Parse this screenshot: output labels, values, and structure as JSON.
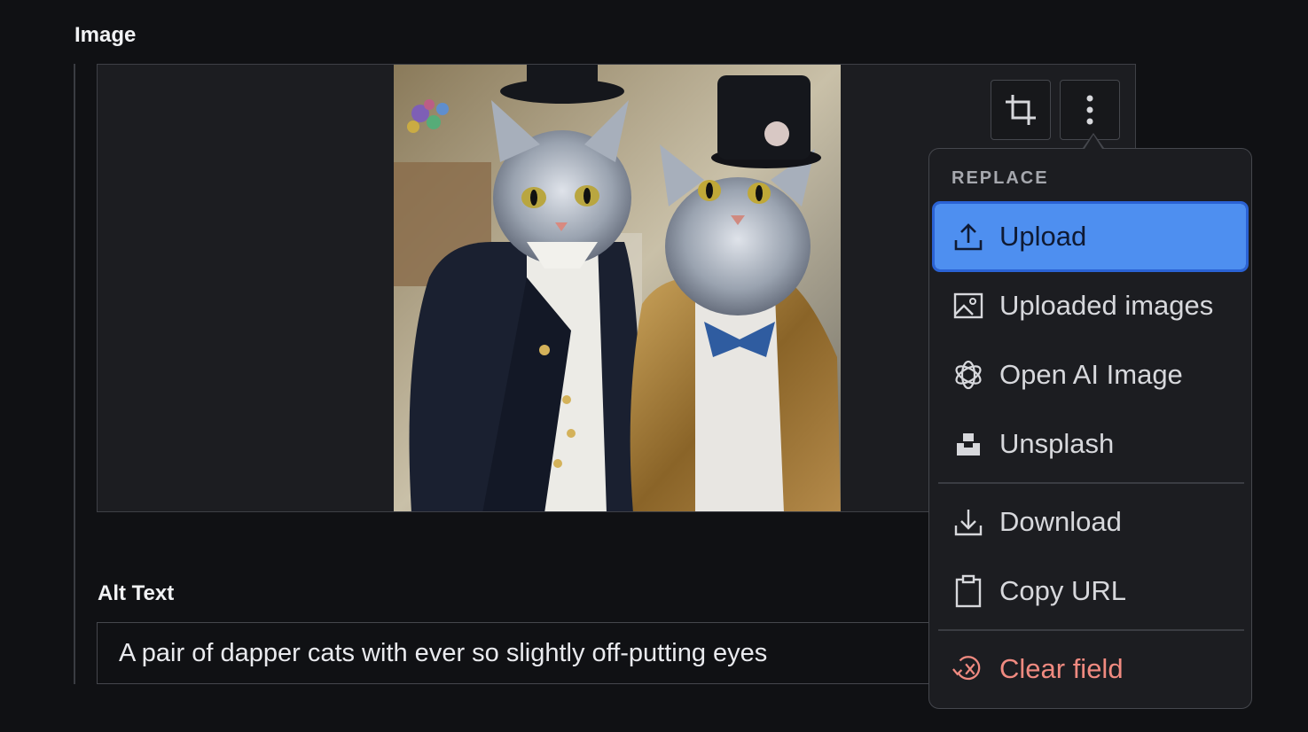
{
  "image_field": {
    "label": "Image"
  },
  "painting": {
    "description_icon": "image-preview"
  },
  "toolbar": {
    "crop_icon": "crop-icon",
    "more_icon": "more-vertical-icon"
  },
  "alt_text": {
    "label": "Alt Text",
    "value": "A pair of dapper cats with ever so slightly off-putting eyes"
  },
  "menu": {
    "heading": "REPLACE",
    "items": [
      {
        "label": "Upload",
        "icon": "upload-icon",
        "active": true
      },
      {
        "label": "Uploaded images",
        "icon": "image-icon"
      },
      {
        "label": "Open AI Image",
        "icon": "openai-icon"
      },
      {
        "label": "Unsplash",
        "icon": "unsplash-icon"
      },
      {
        "label": "Download",
        "icon": "download-icon"
      },
      {
        "label": "Copy URL",
        "icon": "clipboard-icon"
      },
      {
        "label": "Clear field",
        "icon": "clear-icon",
        "danger": true
      }
    ]
  },
  "colors": {
    "background": "#101114",
    "panel": "#1c1d21",
    "accent": "#4e8ff0",
    "danger": "#f08a80"
  }
}
